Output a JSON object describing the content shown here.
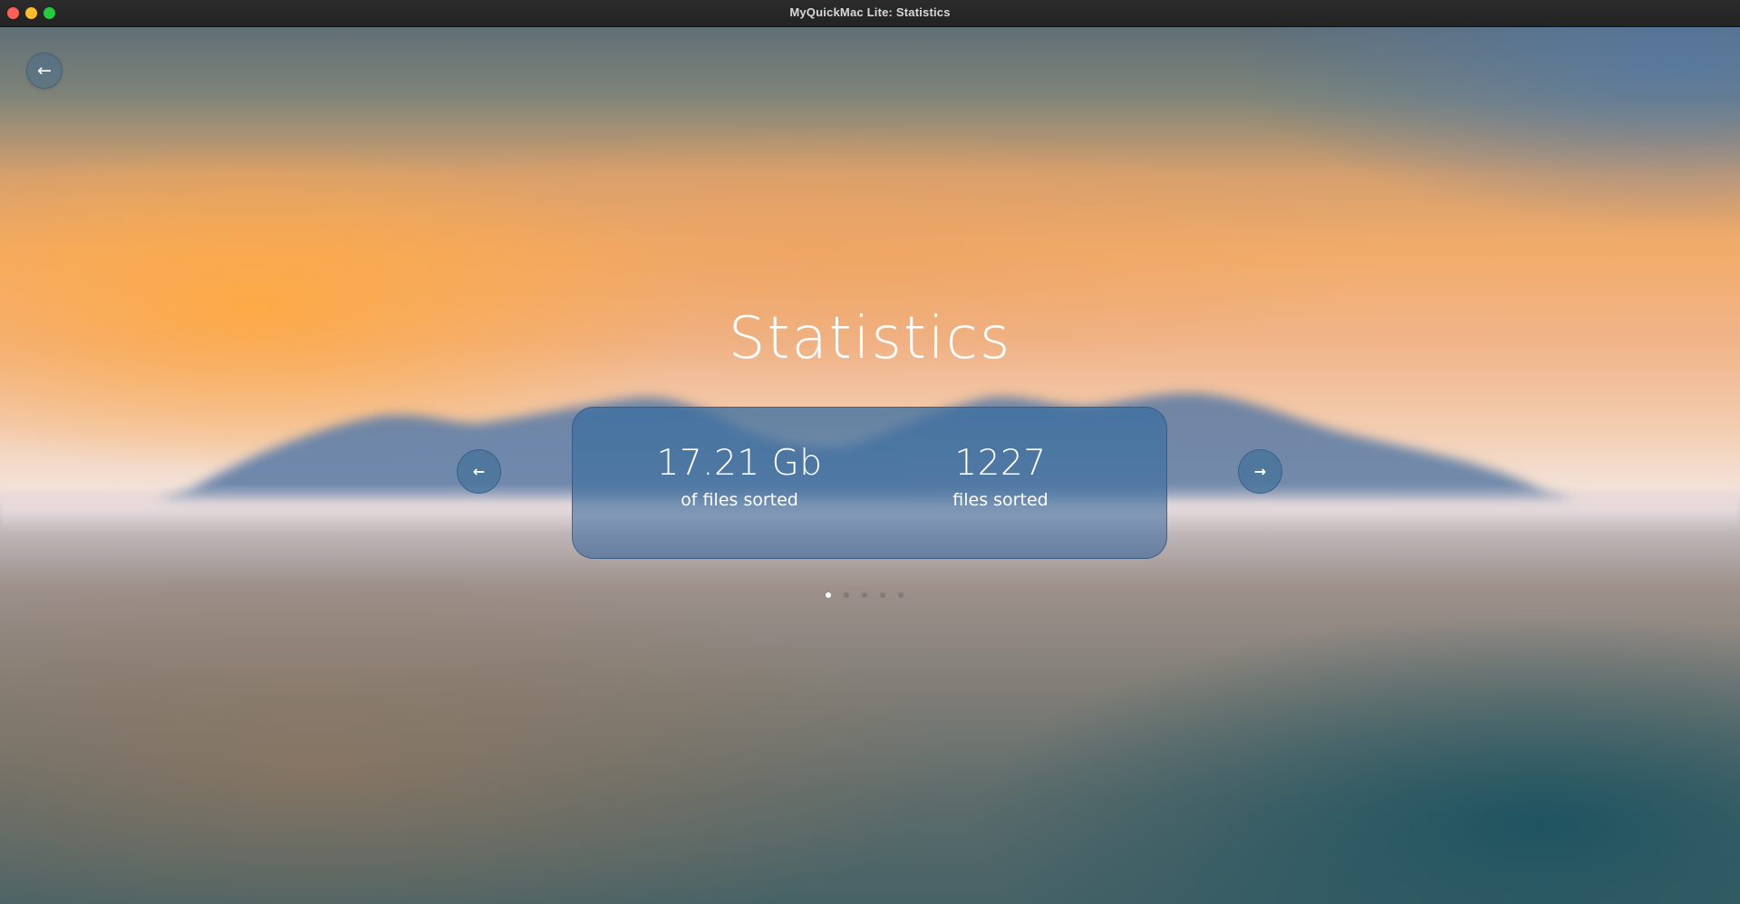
{
  "window": {
    "title": "MyQuickMac Lite: Statistics"
  },
  "page": {
    "title": "Statistics"
  },
  "icons": {
    "back": "arrow-left-icon",
    "prev": "arrow-left-icon",
    "next": "arrow-right-icon"
  },
  "stats": [
    {
      "value": "17.21 Gb",
      "caption": "of files sorted"
    },
    {
      "value": "1227",
      "caption": "files sorted"
    }
  ],
  "pager": {
    "count": 5,
    "active_index": 0
  },
  "colors": {
    "card": "#3c6ea0",
    "accent_button": "#4673a0",
    "text": "#ffffff",
    "traffic_close": "#ff5f57",
    "traffic_minimize": "#febc2e",
    "traffic_zoom": "#28c840"
  }
}
